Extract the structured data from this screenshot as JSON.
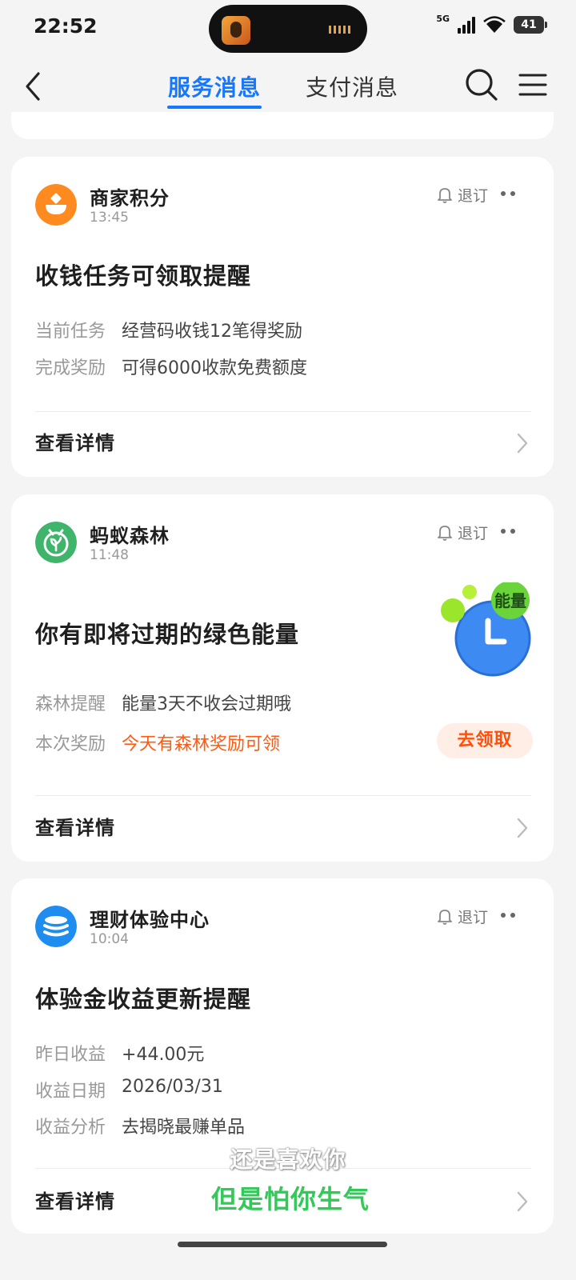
{
  "status_bar": {
    "time": "22:52",
    "network": "5G",
    "battery": "41"
  },
  "nav": {
    "tabs": [
      {
        "label": "服务消息",
        "active": true
      },
      {
        "label": "支付消息",
        "active": false
      }
    ]
  },
  "colors": {
    "accent": "#1677ff",
    "orange": "#ff5a12",
    "points_logo": "#ff8a1f",
    "forest_logo": "#3fb56b",
    "finance_logo": "#1f8cf0"
  },
  "cards": [
    {
      "source": "商家积分",
      "time": "13:45",
      "logo_icon": "merchant-points-icon",
      "unsubscribe": "退订",
      "title": "收钱任务可领取提醒",
      "rows": [
        {
          "key": "当前任务",
          "value": "经营码收钱12笔得奖励"
        },
        {
          "key": "完成奖励",
          "value": "可得6000收款免费额度"
        }
      ],
      "detail": "查看详情"
    },
    {
      "source": "蚂蚁森林",
      "time": "11:48",
      "logo_icon": "ant-forest-icon",
      "unsubscribe": "退订",
      "title": "你有即将过期的绿色能量",
      "energy_badge": "能量",
      "rows": [
        {
          "key": "森林提醒",
          "value": "能量3天不收会过期哦"
        },
        {
          "key": "本次奖励",
          "value": "今天有森林奖励可领"
        }
      ],
      "action": "去领取",
      "detail": "查看详情"
    },
    {
      "source": "理财体验中心",
      "time": "10:04",
      "logo_icon": "wealth-center-icon",
      "unsubscribe": "退订",
      "title": "体验金收益更新提醒",
      "rows": [
        {
          "key": "昨日收益",
          "value": "+44.00元"
        },
        {
          "key": "收益日期",
          "value": "2026/03/31"
        },
        {
          "key": "收益分析",
          "value": "去揭晓最赚单品"
        }
      ],
      "detail": "查看详情"
    }
  ],
  "subtitles": {
    "line1": "还是喜欢你",
    "line2": "但是怕你生气"
  }
}
